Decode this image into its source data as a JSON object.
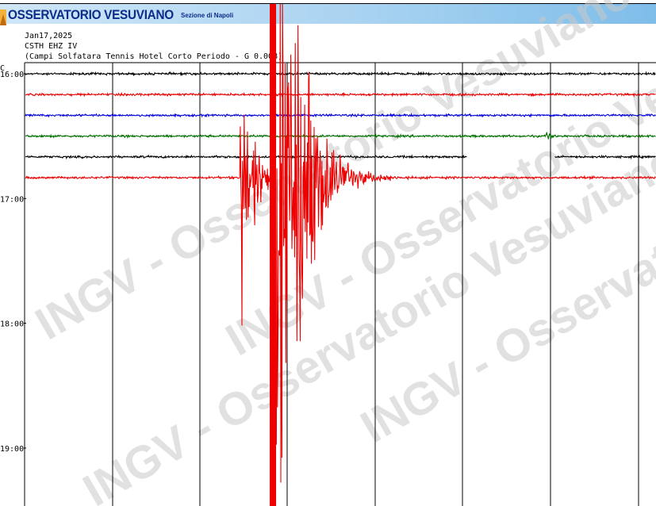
{
  "banner": {
    "title": "OSSERVATORIO VESUVIANO",
    "subtitle": "Sezione di Napoli"
  },
  "header": {
    "date": "Jan17,2025",
    "station": "CSTH EHZ IV",
    "description": "(Campi Solfatara Tennis Hotel Corto Periodo - G 0.008)",
    "corner_mark": "C"
  },
  "watermark": "INGV - Osservatorio Vesuviano",
  "colors": {
    "banner_text": "#0b2c8a",
    "trace_cycle": [
      "#000000",
      "#ee0000",
      "#0000dd",
      "#007000"
    ],
    "grid": "#000000",
    "watermark": "#c8c8c8"
  },
  "chart_data": {
    "type": "line",
    "title": "",
    "xlabel": "",
    "ylabel": "",
    "row_minutes": 10,
    "time_labels": [
      "16:00",
      "17:00",
      "18:00",
      "19:00"
    ],
    "rows": [
      {
        "index": 0,
        "color": "black",
        "amplitude": "quiet"
      },
      {
        "index": 1,
        "color": "red",
        "amplitude": "quiet"
      },
      {
        "index": 2,
        "color": "blue",
        "amplitude": "quiet"
      },
      {
        "index": 3,
        "color": "green",
        "amplitude": "quiet",
        "note": "small burst near minute 8.3"
      },
      {
        "index": 4,
        "color": "black",
        "amplitude": "quiet",
        "gap_minutes": [
          7.0,
          8.4
        ]
      },
      {
        "index": 5,
        "color": "red",
        "amplitude": "earthquake",
        "events": [
          {
            "minute": 3.4,
            "strength": "large"
          },
          {
            "minute": 3.9,
            "strength": "very large, clipped"
          },
          {
            "minute": 4.3,
            "strength": "large"
          }
        ]
      }
    ],
    "vertical_gridlines": 8,
    "grid": true
  }
}
